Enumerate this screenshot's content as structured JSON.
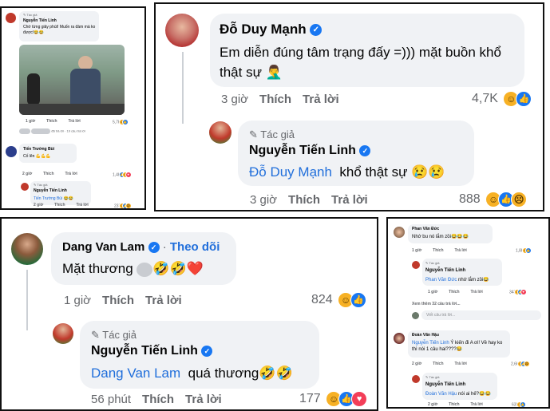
{
  "p1": {
    "author_label": "Tác giả",
    "author_name": "Nguyễn Tiến Linh",
    "post_text": "Chờ từng giây phút! Muốn ra đàm mà ko được!😂😂",
    "post_time": "1 giờ",
    "post_like": "Thích",
    "post_reply": "Trả lời",
    "post_count": "5,7K",
    "hidden_suffix": "đã trả lời · 19 câu trả lời",
    "c1_name": "Tiến Trường Bùi",
    "c1_text": "Cố lên 💪💪💪",
    "c1_time": "2 giờ",
    "c1_like": "Thích",
    "c1_reply": "Trả lời",
    "c1_count": "1,4K",
    "r1_author_label": "Tác giả",
    "r1_name": "Nguyễn Tiến Linh",
    "r1_mention": "Tiến Trường Bùi",
    "r1_emoji": "😂😂",
    "r1_time": "2 giờ",
    "r1_like": "Thích",
    "r1_reply": "Trả lời",
    "r1_count": "237"
  },
  "p2": {
    "c_name": "Đỗ Duy Mạnh",
    "c_text": "Em diễn đúng tâm trạng đấy =))) mặt buồn khổ thật sự 🤦‍♂️",
    "c_time": "3 giờ",
    "c_like": "Thích",
    "c_reply": "Trả lời",
    "c_count": "4,7K",
    "r_author_label": "Tác giả",
    "r_name": "Nguyễn Tiến Linh",
    "r_mention": "Đỗ Duy Mạnh",
    "r_text": "khổ thật sự 😢😢",
    "r_time": "3 giờ",
    "r_like": "Thích",
    "r_reply": "Trả lời",
    "r_count": "888"
  },
  "p3": {
    "c_name": "Dang Van Lam",
    "c_follow": "Theo dõi",
    "c_text": "Mặt thương",
    "c_emoji": "🤣🤣❤️",
    "c_time": "1 giờ",
    "c_like": "Thích",
    "c_reply": "Trả lời",
    "c_count": "824",
    "r_author_label": "Tác giả",
    "r_name": "Nguyễn Tiến Linh",
    "r_mention": "Dang Van Lam",
    "r_text": "quá thương🤣🤣",
    "r_time": "56 phút",
    "r_like": "Thích",
    "r_reply": "Trả lời",
    "r_count": "177"
  },
  "p4": {
    "c1_name": "Phan Văn Đức",
    "c1_text": "Nhớ bu nó lắm zồi😂😂😂",
    "c1_time": "1 giờ",
    "c1_like": "Thích",
    "c1_reply": "Trả lời",
    "c1_count": "1,8K",
    "r1_author_label": "Tác giả",
    "r1_name": "Nguyễn Tiến Linh",
    "r1_mention": "Phan Văn Đức",
    "r1_text": "nhớ lắm zồi😂",
    "r1_time": "1 giờ",
    "r1_like": "Thích",
    "r1_reply": "Trả lời",
    "r1_count": "343",
    "more_replies": "Xem thêm 32 câu trả lời...",
    "write_placeholder": "Viết câu trả lời...",
    "c2_name": "Đoàn Văn Hậu",
    "c2_mention": "Nguyễn Tiến Linh",
    "c2_text": "Ý kiến đi A ơi! Về hay ko thì nói 1 câu hai????😂",
    "c2_time": "2 giờ",
    "c2_like": "Thích",
    "c2_reply": "Trả lời",
    "c2_count": "2,6K",
    "r2_author_label": "Tác giả",
    "r2_name": "Nguyễn Tiến Linh",
    "r2_mention": "Đoàn Văn Hậu",
    "r2_text": "nói ai hế?😂😂",
    "r2_time": "2 giờ",
    "r2_like": "Thích",
    "r2_reply": "Trả lời",
    "r2_count": "638"
  }
}
